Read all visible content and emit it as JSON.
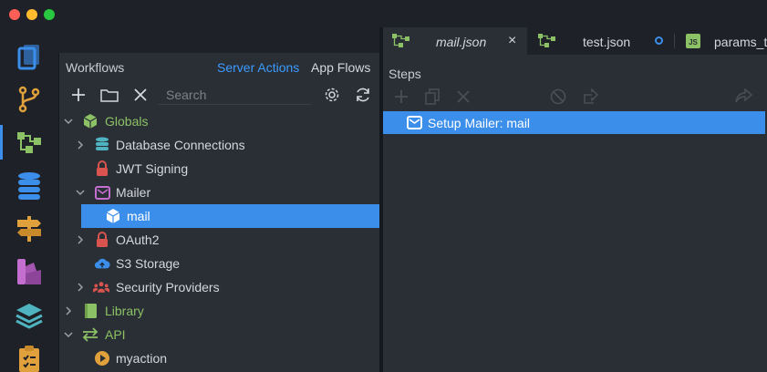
{
  "window": {
    "controls": [
      "close",
      "minimize",
      "zoom"
    ]
  },
  "activity_bar": [
    {
      "icon": "files-icon",
      "color": "#3b8eea"
    },
    {
      "icon": "git-branch-icon",
      "color": "#e0a03c"
    },
    {
      "icon": "workflow-icon",
      "color": "#8cc265",
      "active": true
    },
    {
      "icon": "database-icon",
      "color": "#3b8eea"
    },
    {
      "icon": "signpost-icon",
      "color": "#e0a03c"
    },
    {
      "icon": "palette-icon",
      "color": "#c46fd0"
    },
    {
      "icon": "layers-icon",
      "color": "#4fb3c0"
    },
    {
      "icon": "clipboard-icon",
      "color": "#e0a03c"
    }
  ],
  "workflows_panel": {
    "title": "Workflows",
    "tabs": [
      "Server Actions",
      "App Flows"
    ],
    "active_tab": "Server Actions",
    "search_placeholder": "Search",
    "tree": [
      {
        "label": "Globals",
        "icon": "cube-icon",
        "expanded": true
      },
      {
        "label": "Database Connections",
        "icon": "database-icon",
        "collapsed": true
      },
      {
        "label": "JWT Signing",
        "icon": "lock-icon"
      },
      {
        "label": "Mailer",
        "icon": "envelope-icon",
        "expanded": true
      },
      {
        "label": "mail",
        "icon": "cube-icon",
        "selected": true
      },
      {
        "label": "OAuth2",
        "icon": "lock-icon",
        "collapsed": true
      },
      {
        "label": "S3 Storage",
        "icon": "cloud-upload-icon"
      },
      {
        "label": "Security Providers",
        "icon": "users-icon",
        "collapsed": true
      },
      {
        "label": "Library",
        "icon": "book-icon",
        "collapsed": true
      },
      {
        "label": "API",
        "icon": "exchange-icon",
        "expanded": true
      },
      {
        "label": "myaction",
        "icon": "play-icon"
      }
    ]
  },
  "editor": {
    "tabs": [
      {
        "label": "mail.json",
        "active": true,
        "close": "×"
      },
      {
        "label": "test.json",
        "modified": true
      },
      {
        "label": "params_te",
        "badge": "JS"
      }
    ],
    "steps_title": "Steps",
    "steps": [
      {
        "label": "Setup Mailer: mail",
        "icon": "envelope-icon",
        "selected": true
      }
    ]
  },
  "colors": {
    "accent": "#3b8eea",
    "link": "#3b9cff",
    "green": "#8cc265",
    "bg_dark": "#1e2228",
    "bg_panel": "#2a2e35"
  }
}
